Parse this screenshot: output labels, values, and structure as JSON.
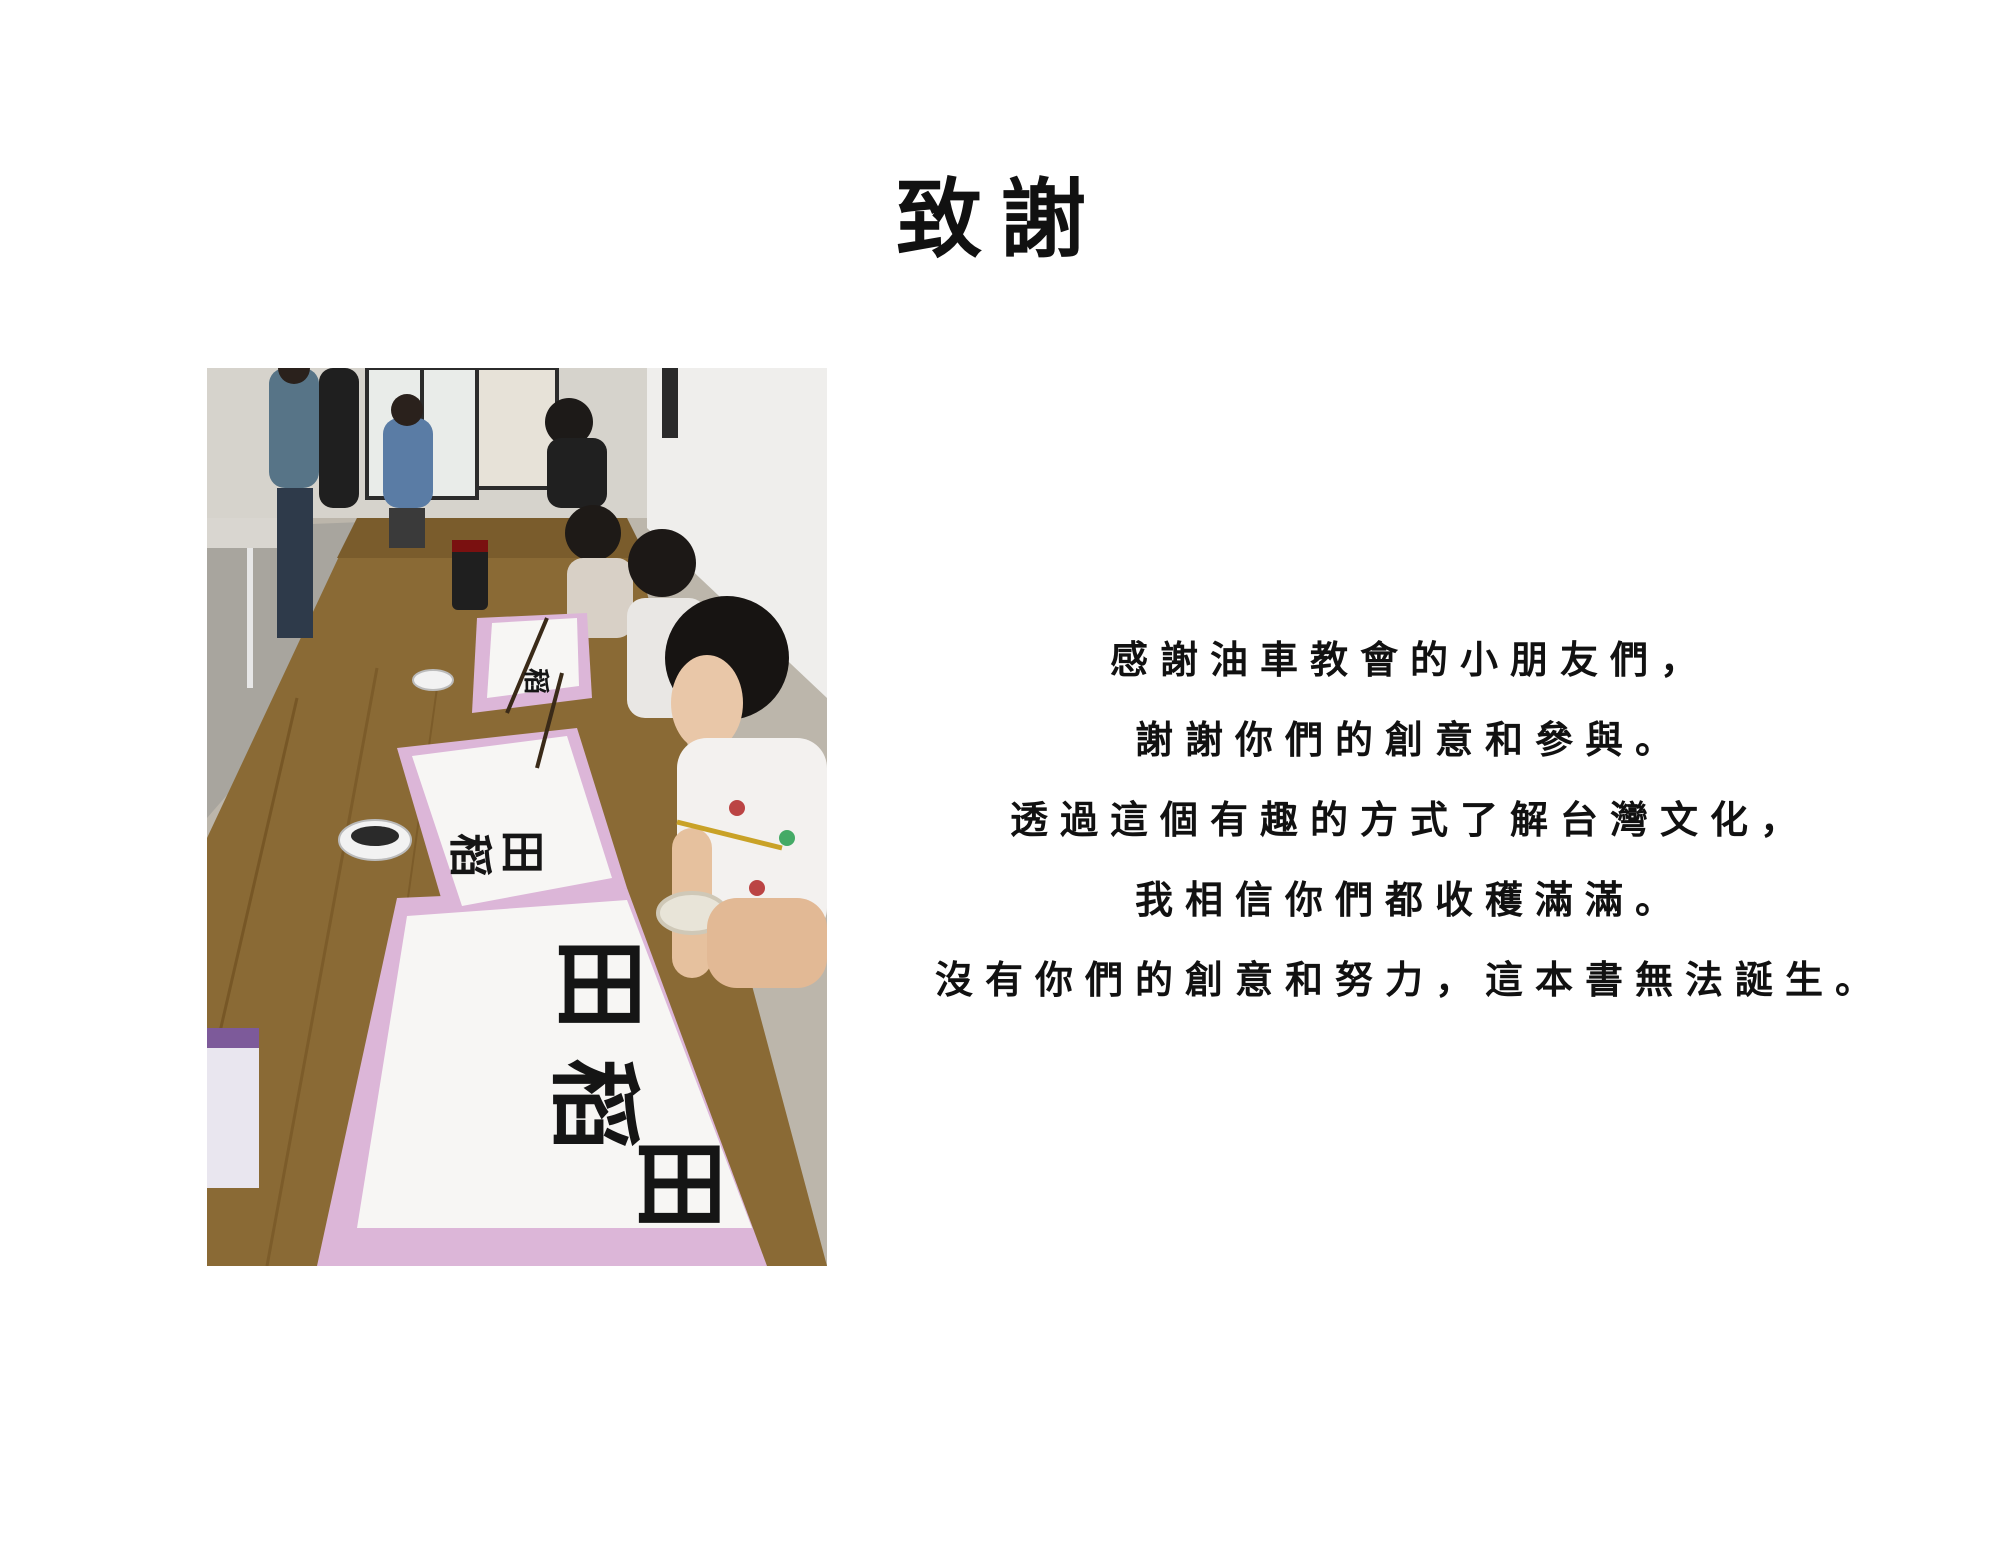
{
  "page": {
    "title": "致謝"
  },
  "photo": {
    "calligraphy": [
      "稻",
      "田",
      "稻",
      "田",
      "稻",
      "田"
    ]
  },
  "message": {
    "lines": [
      "感謝油車教會的小朋友們，",
      "謝謝你們的創意和參與。",
      "透過這個有趣的方式了解台灣文化，",
      "我相信你們都收穫滿滿。",
      "沒有你們的創意和努力，這本書無法誕生。"
    ]
  },
  "colors": {
    "table": "#8a6a35",
    "tissue": "#dcb6d8",
    "paper": "#f7f6f4",
    "ink": "#151515"
  }
}
